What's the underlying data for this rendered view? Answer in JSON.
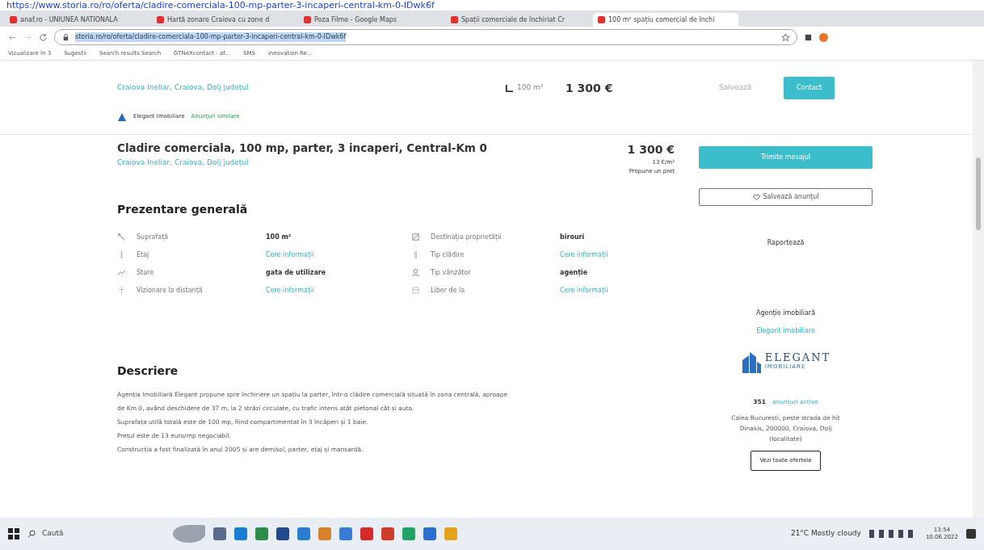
{
  "top_link": "https://www.storia.ro/ro/oferta/cladire-comerciala-100-mp-parter-3-incaperi-central-km-0-IDwk6f",
  "tabs": [
    {
      "title": "anaf.ro - UNIUNEA NATIONALA",
      "selected": false
    },
    {
      "title": "Hartă zonare Craiova cu zone d",
      "selected": false
    },
    {
      "title": "Poza Filme - Google Maps",
      "selected": false
    },
    {
      "title": "Spații comerciale de închiriat Cr",
      "selected": false
    },
    {
      "title": "100 m² spațiu comercial de închi",
      "selected": true
    }
  ],
  "address": "storia.ro/ro/oferta/cladire-comerciala-100-mp-parter-3-incaperi-central-km-0-IDwk6f",
  "bookmarks": [
    "Vizualizare în 3",
    "Sugestii",
    "Search results Search",
    "GTNeXcontact - af...",
    "SMS",
    "innovation Re..."
  ],
  "sticky": {
    "location": "Craiova Ineliar, Craiova, Dolj județul",
    "area": "100 m²",
    "price": "1 300 €",
    "save": "Salvează",
    "contact": "Contact",
    "agency": "Elegant Imobiliare",
    "similar": "Anunțuri similare"
  },
  "listing": {
    "title": "Cladire comerciala, 100 mp, parter, 3 incaperi, Central-Km 0",
    "location": "Craiova Ineliar, Craiova, Dolj județul",
    "price": "1 300 €",
    "price_per_m2": "13 €/m²",
    "propose": "Propune un preț",
    "send": "Trimite mesajul",
    "save": "Salvează anunțul",
    "report": "Raportează"
  },
  "overview": {
    "heading": "Prezentare generală",
    "items": [
      {
        "label": "Suprafață",
        "value": "100 m²",
        "kind": "bold"
      },
      {
        "label": "Destinația proprietății",
        "value": "birouri",
        "kind": "bold"
      },
      {
        "label": "Etaj",
        "value": "Cere informații",
        "kind": "link"
      },
      {
        "label": "Tip clădire",
        "value": "Cere informații",
        "kind": "link"
      },
      {
        "label": "Stare",
        "value": "gata de utilizare",
        "kind": "bold"
      },
      {
        "label": "Tip vânzător",
        "value": "agenție",
        "kind": "bold"
      },
      {
        "label": "Vizionare la distanță",
        "value": "Cere informații",
        "kind": "link"
      },
      {
        "label": "Liber de la",
        "value": "Cere informații",
        "kind": "link"
      }
    ]
  },
  "description": {
    "heading": "Descriere",
    "lines": [
      "Agenția Imobiliară Elegant propune spre închiriere un spațiu la parter, într-o clădire comercială situată în zona centrală, aproape",
      "de Km 0, având deschidere de 37 m, la 2 străzi circulate, cu trafic intens atât pietonal cât și auto.",
      "Suprafața utilă totală este de 100 mp, fiind compartimentat în 3 încăperi și 1 baie.",
      "Prețul este de 13 euro/mp negociabil.",
      "Construcția a fost finalizată în anul 2005 și are demisol, parter, etaj și mansardă."
    ]
  },
  "agency": {
    "label": "Agenție imobiliară",
    "name": "Elegant Imobiliare",
    "logo_title": "ELEGANT",
    "logo_sub": "IMOBILIARE",
    "count": "351",
    "count_link": "anunțuri active",
    "address": "Calea București, peste strada de hit Dinakis, 200000, Craiova, Dolj (localitate)",
    "all_offers": "Vezi toate ofertele"
  },
  "taskbar": {
    "search": "Caută",
    "weather": "21°C Mostly cloudy",
    "time": "13:54",
    "date": "10.06.2022"
  }
}
